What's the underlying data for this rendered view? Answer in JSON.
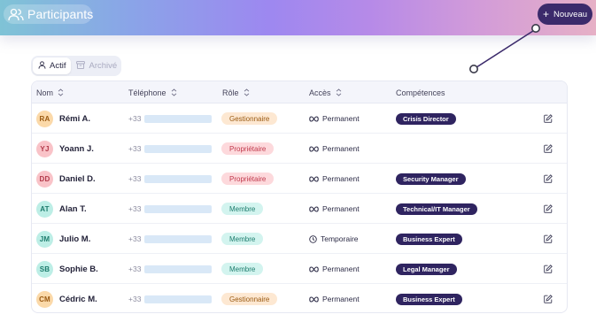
{
  "header": {
    "title": "Participants",
    "new_button": "Nouveau",
    "gradient_colors": [
      "#7fc3d6",
      "#9d88f0",
      "#e6b0c6"
    ],
    "accent": "#3b2a6b"
  },
  "tabs": [
    {
      "label": "Actif",
      "icon": "user-icon",
      "active": true
    },
    {
      "label": "Archivé",
      "icon": "archive-icon",
      "active": false
    }
  ],
  "table": {
    "columns": {
      "name": "Nom",
      "phone": "Téléphone",
      "role": "Rôle",
      "access": "Accès",
      "skills": "Compétences"
    },
    "rows": [
      {
        "initials": "RA",
        "name": "Rémi A.",
        "phone": "+33",
        "role": "Gestionnaire",
        "access": "Permanent",
        "access_icon": "infinity-icon",
        "skill": "Crisis Director",
        "avatar_color": "orange"
      },
      {
        "initials": "YJ",
        "name": "Yoann J.",
        "phone": "+33",
        "role": "Propriétaire",
        "access": "Permanent",
        "access_icon": "infinity-icon",
        "skill": "",
        "avatar_color": "red"
      },
      {
        "initials": "DD",
        "name": "Daniel D.",
        "phone": "+33",
        "role": "Propriétaire",
        "access": "Permanent",
        "access_icon": "infinity-icon",
        "skill": "Security Manager",
        "avatar_color": "red"
      },
      {
        "initials": "AT",
        "name": "Alan T.",
        "phone": "+33",
        "role": "Membre",
        "access": "Permanent",
        "access_icon": "infinity-icon",
        "skill": "Technical/IT Manager",
        "avatar_color": "teal"
      },
      {
        "initials": "JM",
        "name": "Julio M.",
        "phone": "+33",
        "role": "Membre",
        "access": "Temporaire",
        "access_icon": "clock-icon",
        "skill": "Business Expert",
        "avatar_color": "teal"
      },
      {
        "initials": "SB",
        "name": "Sophie B.",
        "phone": "+33",
        "role": "Membre",
        "access": "Permanent",
        "access_icon": "infinity-icon",
        "skill": "Legal Manager",
        "avatar_color": "teal"
      },
      {
        "initials": "CM",
        "name": "Cédric M.",
        "phone": "+33",
        "role": "Gestionnaire",
        "access": "Permanent",
        "access_icon": "infinity-icon",
        "skill": "Business Expert",
        "avatar_color": "orange"
      }
    ]
  },
  "colors": {
    "orange": {
      "bg": "#fbd9a9",
      "fg": "#9a5a12"
    },
    "red": {
      "bg": "#f9c3c8",
      "fg": "#b23a4a"
    },
    "teal": {
      "bg": "#bdeee6",
      "fg": "#1d7c6d"
    },
    "role_gestionnaire": {
      "bg": "#fde8d2",
      "fg": "#9a5a12"
    },
    "role_proprietaire": {
      "bg": "#fdd9dc",
      "fg": "#c0394c"
    },
    "role_membre": {
      "bg": "#d3f4ef",
      "fg": "#1d7c6d"
    },
    "skill_bg": "#2f2460"
  }
}
